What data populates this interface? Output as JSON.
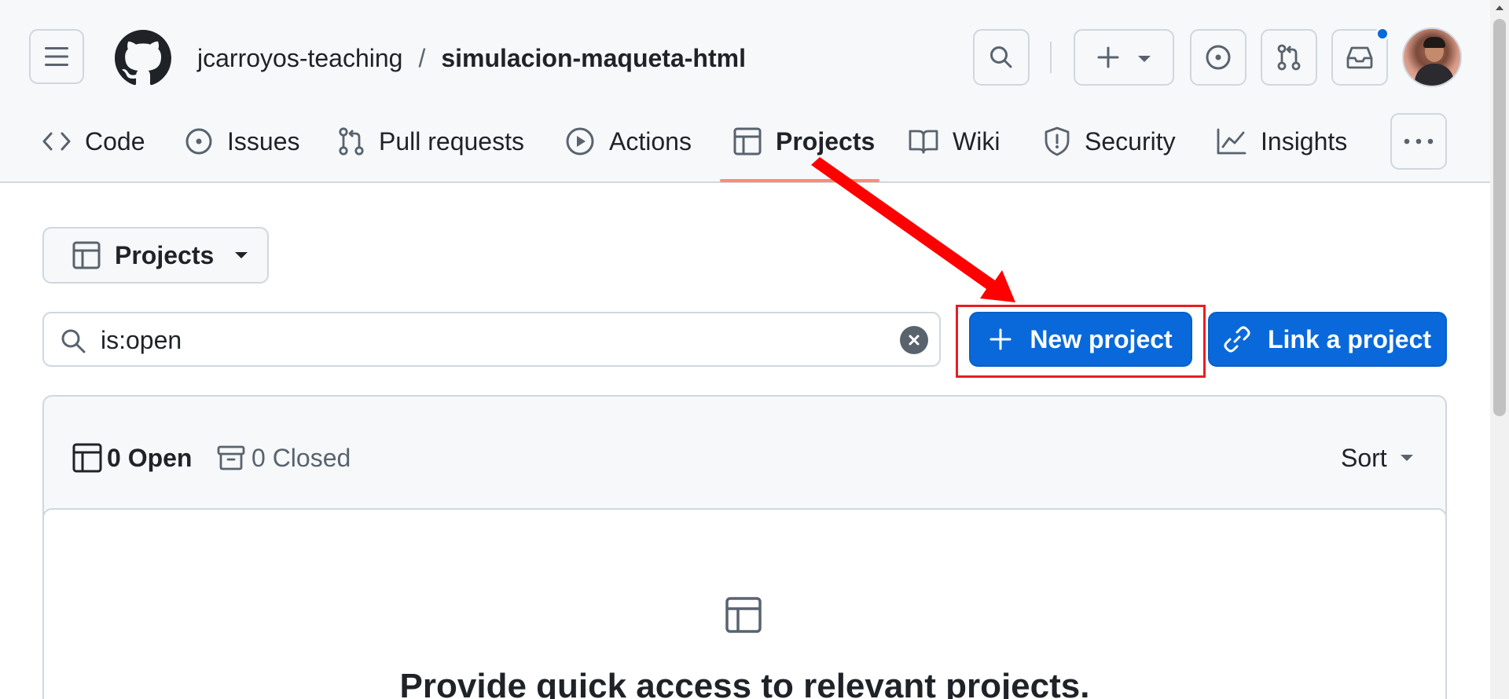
{
  "header": {
    "repo_owner": "jcarroyos-teaching",
    "separator": "/",
    "repo_name": "simulacion-maqueta-html",
    "icons": [
      "menu-icon",
      "github-logo-icon",
      "search-icon",
      "plus-icon",
      "triangle-down-icon",
      "issue-opened-icon",
      "git-pull-request-icon",
      "inbox-icon"
    ]
  },
  "tabs": [
    {
      "label": "Code",
      "icon": "code-icon",
      "selected": false
    },
    {
      "label": "Issues",
      "icon": "issue-opened-icon",
      "selected": false
    },
    {
      "label": "Pull requests",
      "icon": "git-pull-request-icon",
      "selected": false
    },
    {
      "label": "Actions",
      "icon": "play-icon",
      "selected": false
    },
    {
      "label": "Projects",
      "icon": "table-icon",
      "selected": true
    },
    {
      "label": "Wiki",
      "icon": "book-icon",
      "selected": false
    },
    {
      "label": "Security",
      "icon": "shield-icon",
      "selected": false
    },
    {
      "label": "Insights",
      "icon": "graph-icon",
      "selected": false
    }
  ],
  "toolbar": {
    "projects_dropdown_label": "Projects",
    "search_value": "is:open",
    "new_project_label": "New project",
    "link_project_label": "Link a project"
  },
  "list": {
    "open_label": "0 Open",
    "closed_label": "0 Closed",
    "sort_label": "Sort"
  },
  "blankslate": {
    "title": "Provide quick access to relevant projects."
  },
  "colors": {
    "accent": "#0969da",
    "tab_underline": "#fd8c73",
    "annotation": "#e81d25",
    "header_bg": "#f6f8fa",
    "border": "#d0d7de"
  }
}
